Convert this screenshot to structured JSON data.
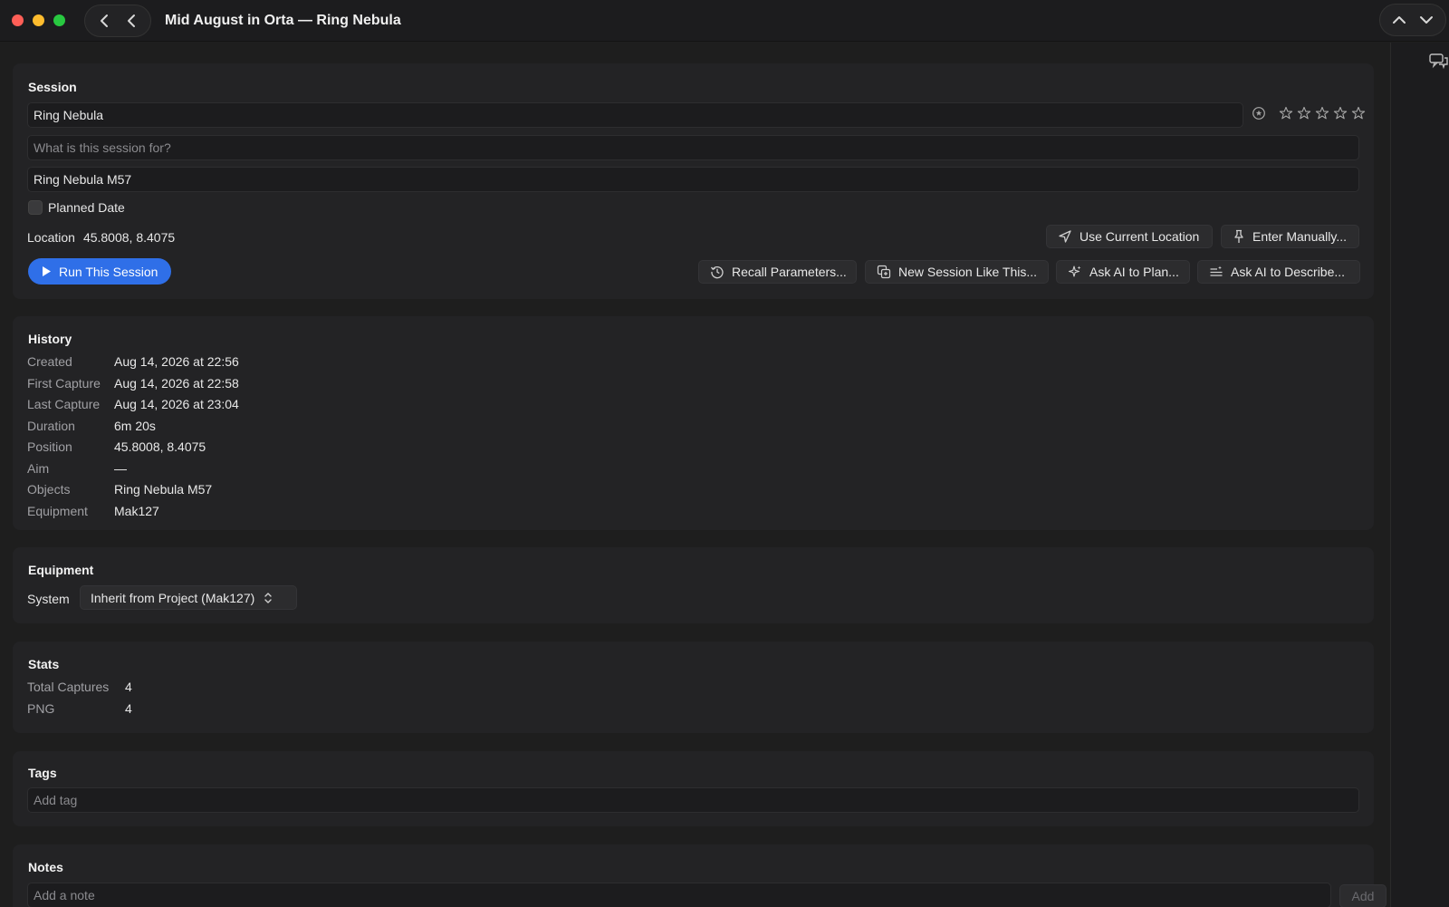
{
  "window": {
    "title": "Mid August in Orta — Ring Nebula",
    "traffic_colors": {
      "close": "#ff5f57",
      "minimize": "#febc2e",
      "zoom": "#28c840"
    }
  },
  "session": {
    "heading": "Session",
    "name_value": "Ring Nebula",
    "rating": 0,
    "rating_max": 5,
    "purpose_placeholder": "What is this session for?",
    "target_value": "Ring Nebula M57",
    "planned_date_label": "Planned Date",
    "planned_date_checked": false,
    "location_label": "Location",
    "location_value": "45.8008, 8.4075",
    "use_current_location": "Use Current Location",
    "enter_manually": "Enter Manually...",
    "run_label": "Run This Session",
    "recall_parameters": "Recall Parameters...",
    "new_session_like": "New Session Like This...",
    "ask_ai_plan": "Ask AI to Plan...",
    "ask_ai_describe": "Ask AI to Describe..."
  },
  "history": {
    "heading": "History",
    "rows": [
      {
        "key": "Created",
        "value": "Aug 14, 2026 at 22:56"
      },
      {
        "key": "First Capture",
        "value": "Aug 14, 2026 at 22:58"
      },
      {
        "key": "Last Capture",
        "value": "Aug 14, 2026 at 23:04"
      },
      {
        "key": "Duration",
        "value": "6m 20s"
      },
      {
        "key": "Position",
        "value": "45.8008, 8.4075"
      },
      {
        "key": "Aim",
        "value": "—"
      },
      {
        "key": "Objects",
        "value": "Ring Nebula M57"
      },
      {
        "key": "Equipment",
        "value": "Mak127"
      }
    ]
  },
  "equipment": {
    "heading": "Equipment",
    "system_label": "System",
    "system_value": "Inherit from Project (Mak127)"
  },
  "stats": {
    "heading": "Stats",
    "rows": [
      {
        "key": "Total Captures",
        "value": "4"
      },
      {
        "key": "PNG",
        "value": "4"
      }
    ]
  },
  "tags": {
    "heading": "Tags",
    "placeholder": "Add tag"
  },
  "notes": {
    "heading": "Notes",
    "placeholder": "Add a note",
    "add_label": "Add"
  },
  "colors": {
    "accent": "#2f6fe8",
    "background": "#1e1e1e",
    "card": "#232325"
  }
}
